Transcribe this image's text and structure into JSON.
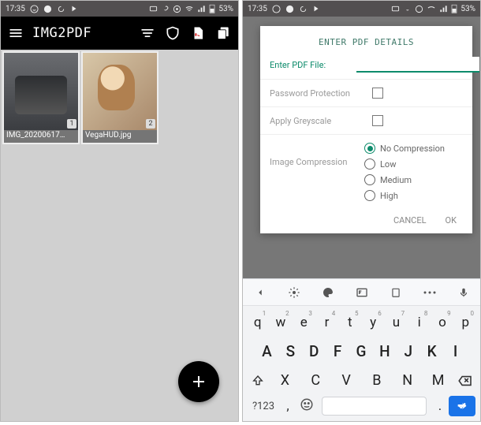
{
  "status": {
    "time": "17:35",
    "battery": "53%"
  },
  "app": {
    "title": "IMG2PDF"
  },
  "gallery": {
    "items": [
      {
        "badge": "1",
        "caption": "IMG_20200617…"
      },
      {
        "badge": "2",
        "caption": "VegaHUD.jpg"
      }
    ]
  },
  "dialog": {
    "title": "ENTER PDF DETAILS",
    "file_label": "Enter PDF File:",
    "file_value": "",
    "password_label": "Password Protection",
    "greyscale_label": "Apply Greyscale",
    "compression_label": "Image Compression",
    "compression_options": {
      "none": "No Compression",
      "low": "Low",
      "medium": "Medium",
      "high": "High"
    },
    "cancel": "CANCEL",
    "ok": "OK"
  },
  "keyboard": {
    "row1": [
      "q",
      "w",
      "e",
      "r",
      "t",
      "y",
      "u",
      "i",
      "o",
      "p"
    ],
    "row1sup": [
      "1",
      "2",
      "3",
      "4",
      "5",
      "6",
      "7",
      "8",
      "9",
      "0"
    ],
    "row2": [
      "A",
      "S",
      "D",
      "F",
      "G",
      "H",
      "J",
      "K",
      "I"
    ],
    "row3": [
      "X",
      "C",
      "V",
      "B",
      "N",
      "M"
    ],
    "sym": "?123",
    "comma": ",",
    "dot": "."
  }
}
